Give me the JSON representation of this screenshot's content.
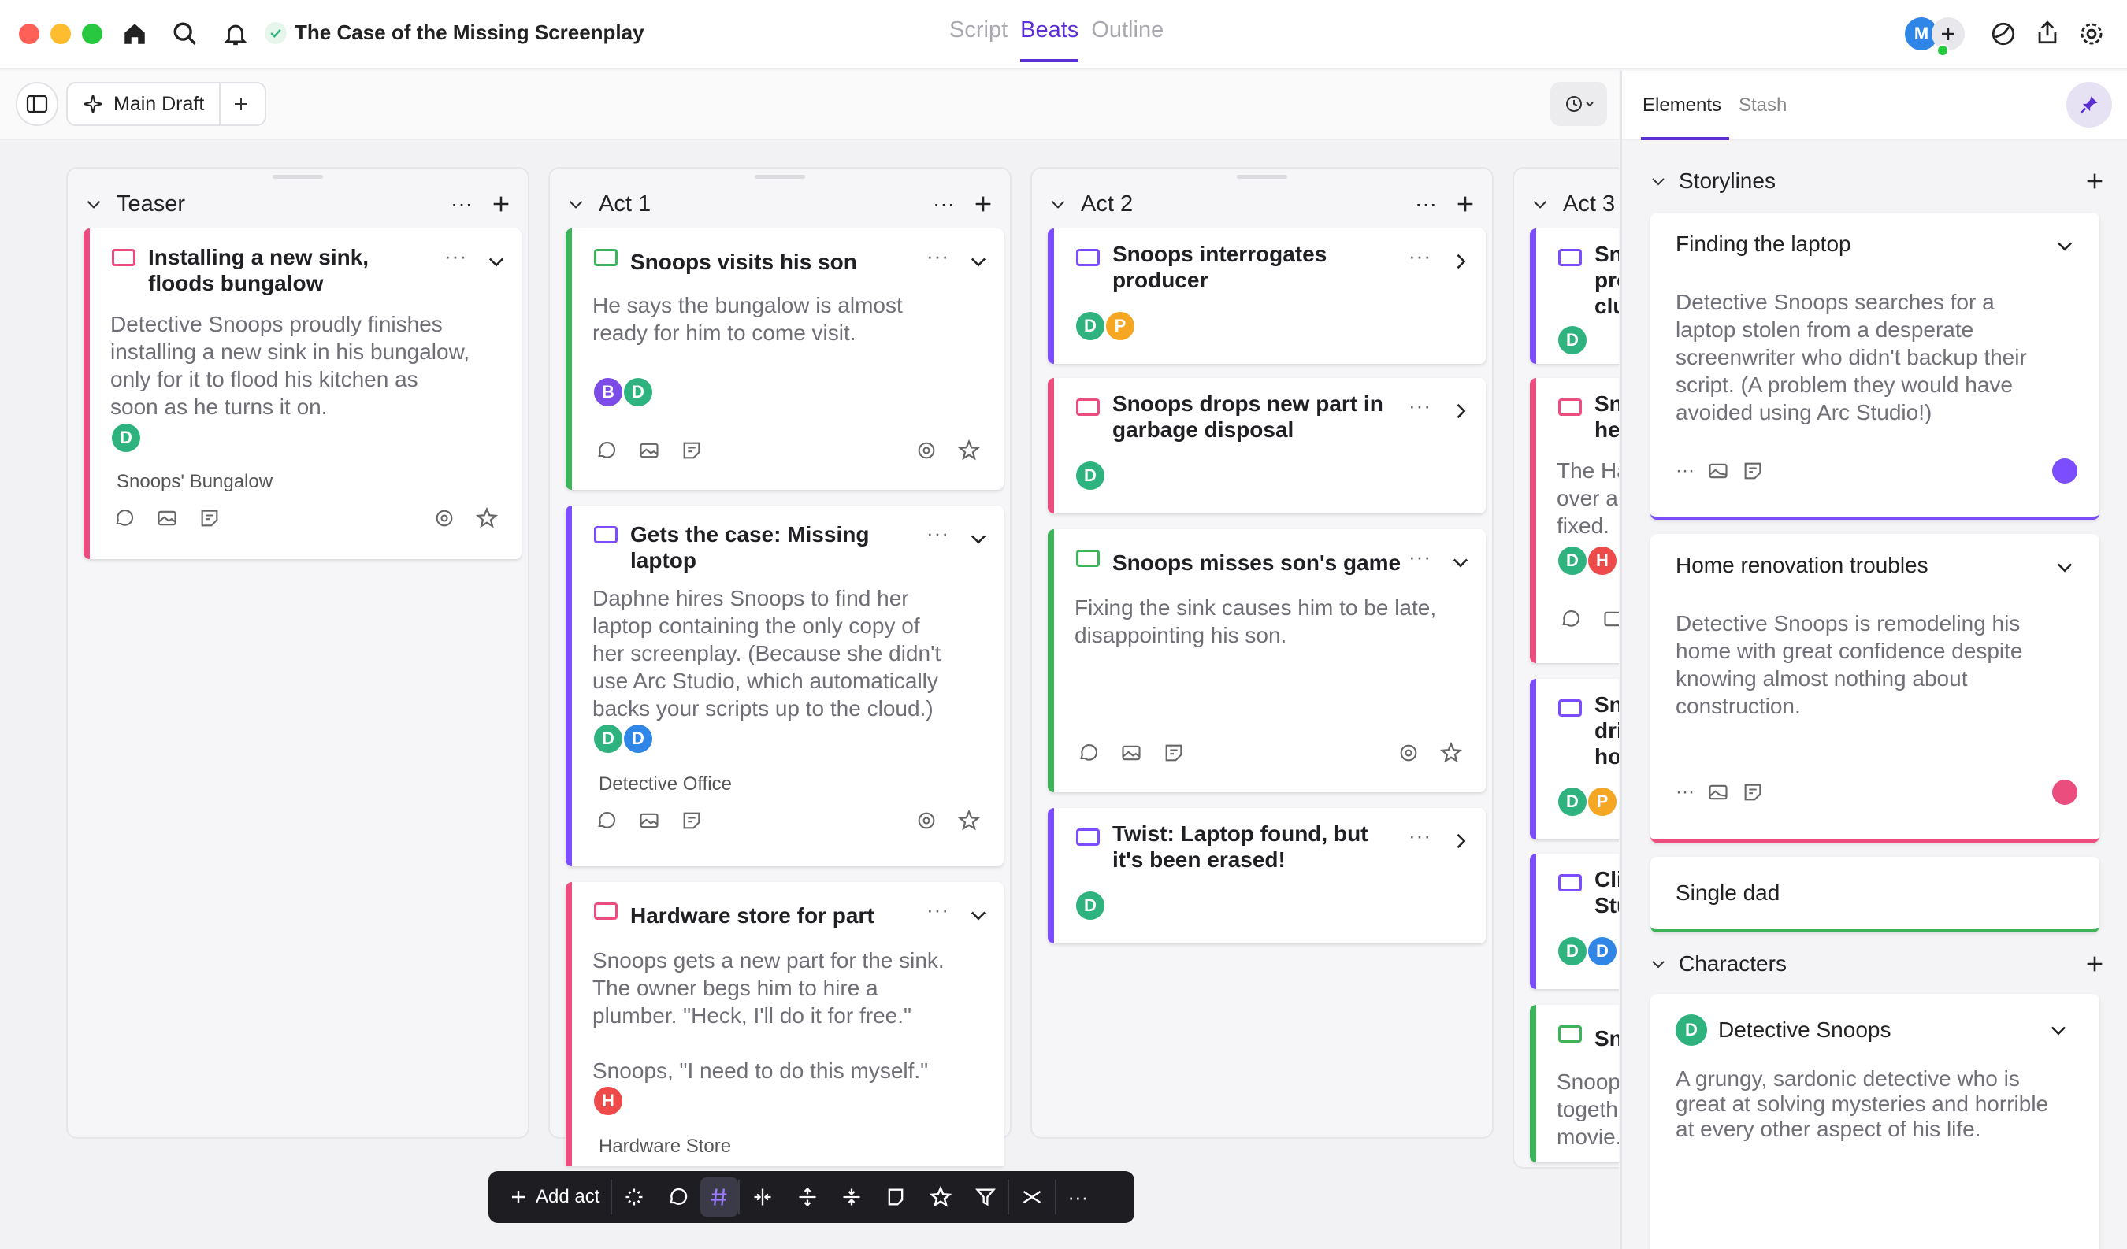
{
  "window": {
    "title": "The Case of the Missing Screenplay"
  },
  "modes": {
    "script": "Script",
    "beats": "Beats",
    "outline": "Outline"
  },
  "draft": {
    "label": "Main Draft"
  },
  "columns": [
    {
      "name": "Teaser",
      "cards": [
        {
          "title_lines": [
            "Installing a new sink,",
            "floods bungalow"
          ],
          "desc_lines": [
            "Detective Snoops proudly finishes",
            "installing a new sink in his bungalow,",
            "only for it to flood his kitchen as",
            "soon as he turns it on."
          ],
          "avatars": [
            "D"
          ],
          "location": "Snoops' Bungalow"
        }
      ]
    },
    {
      "name": "Act 1",
      "cards": [
        {
          "title_lines": [
            "Snoops visits his son"
          ],
          "desc_lines": [
            "He says the bungalow is almost",
            "ready for him to come visit."
          ],
          "avatars": [
            "B",
            "D"
          ]
        },
        {
          "title_lines": [
            "Gets the case: Missing",
            "laptop"
          ],
          "desc_lines": [
            "Daphne hires Snoops to find her",
            "laptop containing the only copy of",
            "her screenplay. (Because she didn't",
            "use Arc Studio, which automatically",
            "backs your scripts up to the cloud.)"
          ],
          "avatars": [
            "D",
            "D"
          ],
          "location": "Detective Office"
        },
        {
          "title_lines": [
            "Hardware store for part"
          ],
          "desc_lines": [
            "Snoops gets a new part for the sink.",
            "The owner begs him to hire a",
            "plumber. \"Heck, I'll do it for free.\"",
            "",
            "Snoops, \"I need to do this myself.\""
          ],
          "avatars": [
            "H"
          ],
          "location": "Hardware Store"
        }
      ]
    },
    {
      "name": "Act 2",
      "cards": [
        {
          "title_lines": [
            "Snoops interrogates",
            "producer"
          ],
          "avatars": [
            "D",
            "P"
          ]
        },
        {
          "title_lines": [
            "Snoops drops new part in",
            "garbage disposal"
          ],
          "avatars": [
            "D"
          ]
        },
        {
          "title_lines": [
            "Snoops misses son's game"
          ],
          "desc_lines": [
            "Fixing the sink causes him to be late,",
            "disappointing his son."
          ]
        },
        {
          "title_lines": [
            "Twist: Laptop found, but",
            "it's been erased!"
          ],
          "avatars": [
            "D"
          ]
        }
      ]
    },
    {
      "name": "Act 3",
      "cards": [
        {
          "title_lines": [
            "Sn",
            "pro",
            "clu"
          ],
          "avatars": [
            "D"
          ]
        },
        {
          "title_lines": [
            "Sn",
            "hel"
          ],
          "desc_lines": [
            "The Ha",
            "over ar",
            "fixed."
          ],
          "avatars": [
            "D",
            "H"
          ]
        },
        {
          "title_lines": [
            "Sn",
            "dri",
            "ho"
          ],
          "avatars": [
            "D",
            "P"
          ]
        },
        {
          "title_lines": [
            "Cli",
            "Stu"
          ],
          "avatars": [
            "D",
            "D"
          ]
        },
        {
          "title_lines": [
            "Sn"
          ],
          "desc_lines": [
            "Snoop",
            "togeth",
            "movie."
          ]
        }
      ]
    }
  ],
  "right_panel": {
    "tabs": [
      "Elements",
      "Stash"
    ],
    "storylines_label": "Storylines",
    "storylines": [
      {
        "title": "Finding the laptop",
        "desc_lines": [
          "Detective Snoops searches for a",
          "laptop stolen from a desperate",
          "screenwriter who didn't backup their",
          "script. (A problem they would have",
          "avoided using Arc Studio!)"
        ],
        "color": "#7c4dff"
      },
      {
        "title": "Home renovation troubles",
        "desc_lines": [
          "Detective Snoops is remodeling his",
          "home with great confidence despite",
          "knowing almost nothing about",
          "construction."
        ],
        "color": "#ec4d7f"
      },
      {
        "title": "Single dad",
        "color": "#3db35a"
      }
    ],
    "characters_label": "Characters",
    "characters": [
      {
        "avatar": "D",
        "name": "Detective Snoops",
        "desc_lines": [
          "A grungy, sardonic detective who is",
          "great at solving mysteries and horrible",
          "at every other aspect of his life."
        ]
      }
    ]
  },
  "bottom_toolbar": {
    "add_act": "Add act"
  },
  "user_avatar": "M",
  "colors": {
    "accent": "#5b2fd4",
    "pink": "#ec4d7f",
    "green": "#3db35a",
    "purple": "#7c4dff",
    "avatar_green": "#2fb37e",
    "avatar_blue": "#2f86e6",
    "avatar_purple": "#7b4ce6",
    "avatar_orange": "#f5a623",
    "avatar_red": "#ef4a4a"
  }
}
